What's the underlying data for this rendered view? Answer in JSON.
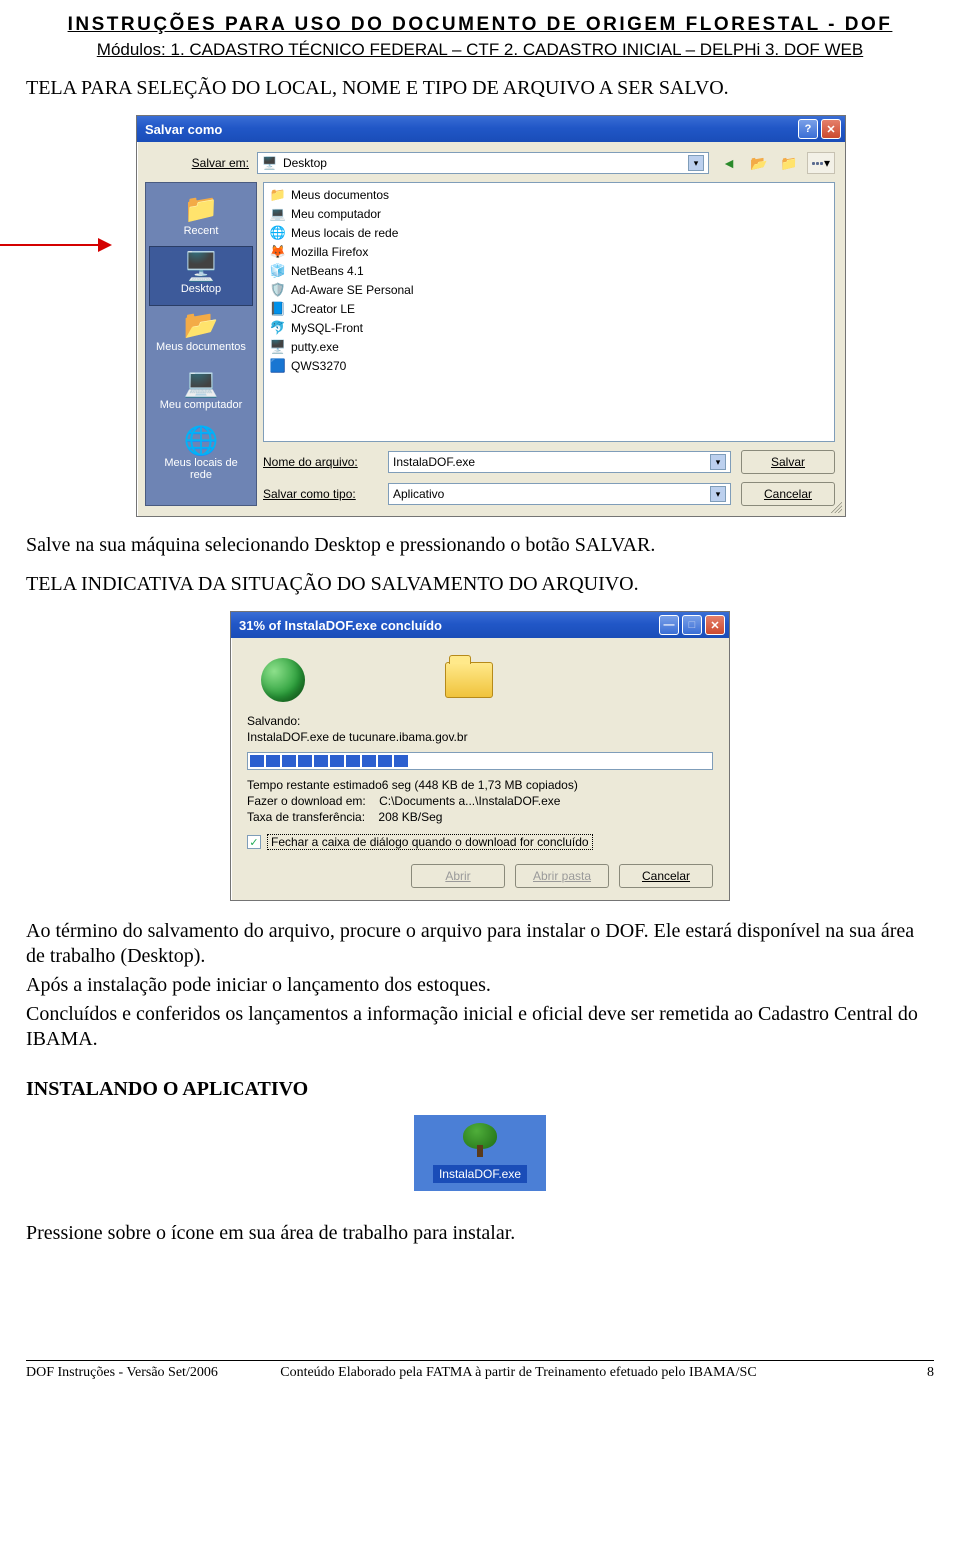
{
  "doc": {
    "title": "INSTRUÇÕES PARA USO DO DOCUMENTO DE ORIGEM FLORESTAL - DOF",
    "subtitle": "Módulos:   1. CADASTRO TÉCNICO FEDERAL – CTF    2. CADASTRO INICIAL – DELPHi   3. DOF WEB",
    "p1": "TELA PARA SELEÇÃO DO LOCAL, NOME E TIPO  DE ARQUIVO A SER SALVO.",
    "p2": "Salve na sua máquina selecionando Desktop e pressionando o botão SALVAR.",
    "p3": "TELA INDICATIVA DA SITUAÇÃO DO SALVAMENTO DO ARQUIVO.",
    "p4": "Ao término do salvamento do arquivo, procure o arquivo para instalar o DOF. Ele estará disponível na sua área de trabalho (Desktop).",
    "p5": "Após a instalação pode iniciar o lançamento dos estoques.",
    "p6": "Concluídos e conferidos os lançamentos a informação inicial e oficial deve ser remetida ao Cadastro Central do IBAMA.",
    "h1": "INSTALANDO O APLICATIVO",
    "p7": "Pressione sobre o ícone em sua área de trabalho para instalar."
  },
  "saveas": {
    "title": "Salvar como",
    "salvar_em_label": "Salvar em:",
    "salvar_em_value": "Desktop",
    "places": [
      {
        "label": "Recent"
      },
      {
        "label": "Desktop"
      },
      {
        "label": "Meus documentos"
      },
      {
        "label": "Meu computador"
      },
      {
        "label": "Meus locais de rede"
      }
    ],
    "files": [
      {
        "icon": "📁",
        "name": "Meus documentos"
      },
      {
        "icon": "💻",
        "name": "Meu computador"
      },
      {
        "icon": "🌐",
        "name": "Meus locais de rede"
      },
      {
        "icon": "🦊",
        "name": "Mozilla Firefox"
      },
      {
        "icon": "🧊",
        "name": "NetBeans 4.1"
      },
      {
        "icon": "🛡️",
        "name": "Ad-Aware SE Personal"
      },
      {
        "icon": "📘",
        "name": "JCreator LE"
      },
      {
        "icon": "🐬",
        "name": "MySQL-Front"
      },
      {
        "icon": "🖥️",
        "name": "putty.exe"
      },
      {
        "icon": "🟦",
        "name": "QWS3270"
      }
    ],
    "nome_label": "Nome do arquivo:",
    "nome_value": "InstalaDOF.exe",
    "tipo_label": "Salvar como tipo:",
    "tipo_value": "Aplicativo",
    "btn_salvar": "Salvar",
    "btn_cancelar": "Cancelar"
  },
  "download": {
    "title": "31% of InstalaDOF.exe concluído",
    "salvando_lbl": "Salvando:",
    "file": "InstalaDOF.exe de tucunare.ibama.gov.br",
    "progress_segments": 10,
    "line1": "Tempo restante estimado6 seg (448 KB de 1,73 MB copiados)",
    "line2_lbl": "Fazer o download em:",
    "line2_val": "C:\\Documents a...\\InstalaDOF.exe",
    "line3_lbl": "Taxa de transferência:",
    "line3_val": "208 KB/Seg",
    "checkbox_label": "Fechar a caixa de diálogo quando o download for concluído",
    "checkbox_checked": true,
    "btn_abrir": "Abrir",
    "btn_pasta": "Abrir pasta",
    "btn_cancelar": "Cancelar"
  },
  "shortcut": {
    "label": "InstalaDOF.exe"
  },
  "footer": {
    "left": "DOF Instruções - Versão Set/2006",
    "center": "Conteúdo Elaborado pela  FATMA à partir de Treinamento efetuado pelo IBAMA/SC",
    "right": "8"
  }
}
